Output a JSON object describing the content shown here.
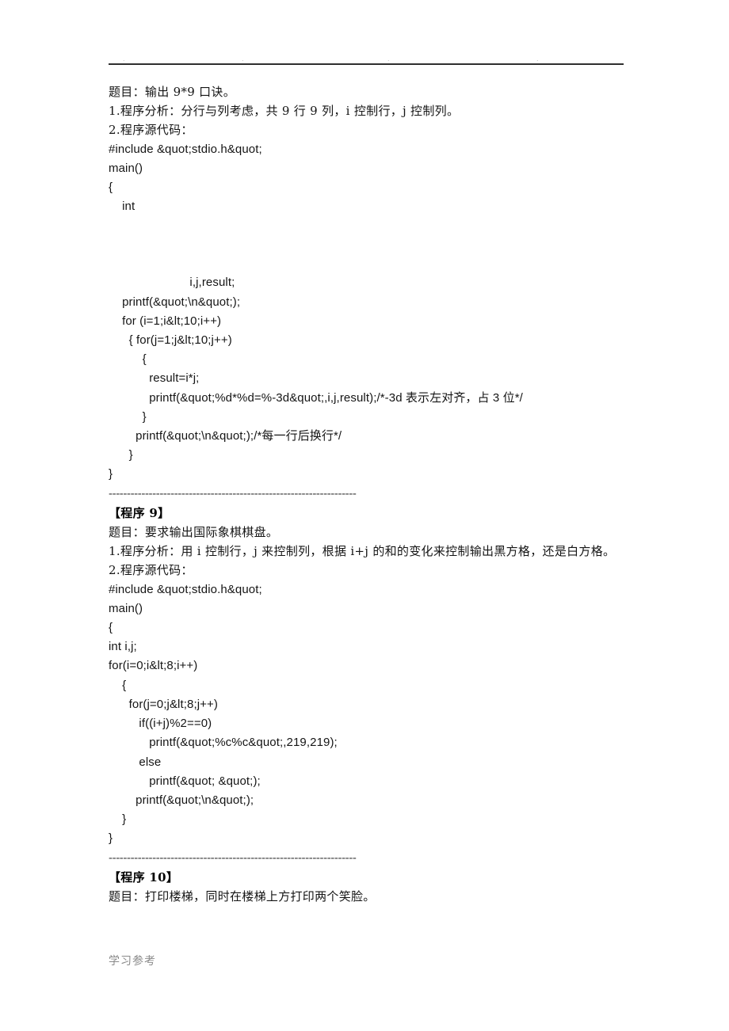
{
  "document": {
    "header": {
      "dots": [
        ".",
        ".",
        ".",
        "."
      ],
      "rule": true
    },
    "footer_text": "学习参考"
  },
  "program8_tail": {
    "title_line": "题目：输出 9*9 口诀。",
    "analysis_line": "1.程序分析：分行与列考虑，共 9 行 9 列，i 控制行，j 控制列。",
    "source_label": "2.程序源代码：",
    "code": [
      "#include &quot;stdio.h&quot;",
      "main()",
      "{",
      "    int",
      "",
      "",
      "",
      "                        i,j,result;",
      "    printf(&quot;\\n&quot;);",
      "    for (i=1;i&lt;10;i++)",
      "      { for(j=1;j&lt;10;j++)",
      "          {",
      "            result=i*j;",
      "            printf(&quot;%d*%d=%-3d&quot;,i,j,result);/*-3d 表示左对齐，占 3 位*/",
      "          }",
      "        printf(&quot;\\n&quot;);/*每一行后换行*/",
      "      }",
      "}"
    ]
  },
  "separators": {
    "dashes": "--------------------------------------------------------------------"
  },
  "program9": {
    "heading": "【程序 9】",
    "title_line": "题目：要求输出国际象棋棋盘。",
    "analysis_line": "1.程序分析：用 i 控制行，j 来控制列，根据 i+j 的和的变化来控制输出黑方格，还是白方格。",
    "source_label": "2.程序源代码：",
    "code": [
      "#include &quot;stdio.h&quot;",
      "main()",
      "{",
      "int i,j;",
      "for(i=0;i&lt;8;i++)",
      "    {",
      "      for(j=0;j&lt;8;j++)",
      "         if((i+j)%2==0)",
      "            printf(&quot;%c%c&quot;,219,219);",
      "         else",
      "            printf(&quot; &quot;);",
      "        printf(&quot;\\n&quot;);",
      "    }",
      "}"
    ]
  },
  "program10": {
    "heading": "【程序 10】",
    "title_line": "题目：打印楼梯，同时在楼梯上方打印两个笑脸。"
  }
}
